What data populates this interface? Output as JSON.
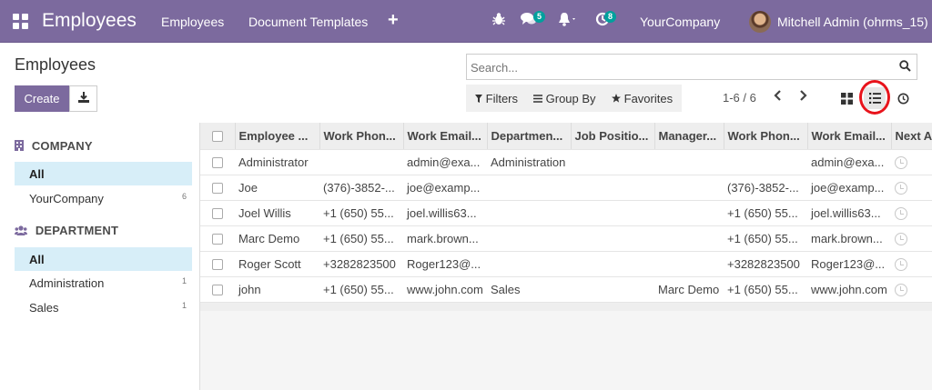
{
  "navbar": {
    "app_title": "Employees",
    "menu": [
      "Employees",
      "Document Templates"
    ],
    "plus": "+",
    "chat_badge": "5",
    "activity_badge": "8",
    "company": "YourCompany",
    "user": "Mitchell Admin (ohrms_15)"
  },
  "control": {
    "title": "Employees",
    "create_label": "Create",
    "search_placeholder": "Search...",
    "filters_label": "Filters",
    "groupby_label": "Group By",
    "favorites_label": "Favorites",
    "pager": "1-6 / 6"
  },
  "sidebar": {
    "company_header": "COMPANY",
    "company_items": [
      {
        "label": "All",
        "count": ""
      },
      {
        "label": "YourCompany",
        "count": "6"
      }
    ],
    "department_header": "DEPARTMENT",
    "department_items": [
      {
        "label": "All",
        "count": ""
      },
      {
        "label": "Administration",
        "count": "1"
      },
      {
        "label": "Sales",
        "count": "1"
      }
    ]
  },
  "table": {
    "headers": [
      "Employee ...",
      "Work Phon...",
      "Work Email...",
      "Departmen...",
      "Job Positio...",
      "Manager...",
      "Work Phon...",
      "Work Email...",
      "Next A"
    ],
    "rows": [
      [
        "Administrator",
        "",
        "admin@exa...",
        "Administration",
        "",
        "",
        "",
        "admin@exa...",
        ""
      ],
      [
        "Joe",
        "(376)-3852-...",
        "joe@examp...",
        "",
        "",
        "",
        "(376)-3852-...",
        "joe@examp...",
        ""
      ],
      [
        "Joel Willis",
        "+1 (650) 55...",
        "joel.willis63...",
        "",
        "",
        "",
        "+1 (650) 55...",
        "joel.willis63...",
        ""
      ],
      [
        "Marc Demo",
        "+1 (650) 55...",
        "mark.brown...",
        "",
        "",
        "",
        "+1 (650) 55...",
        "mark.brown...",
        ""
      ],
      [
        "Roger Scott",
        "+3282823500",
        "Roger123@...",
        "",
        "",
        "",
        "+3282823500",
        "Roger123@...",
        ""
      ],
      [
        "john",
        "+1 (650) 55...",
        "www.john.com",
        "Sales",
        "",
        "Marc Demo",
        "+1 (650) 55...",
        "www.john.com",
        ""
      ]
    ]
  },
  "colors": {
    "brand": "#7c6a9e",
    "badge": "#00a09d",
    "active_filter_bg": "#d7eef8",
    "highlight_ring": "#e8131b"
  },
  "icons": [
    "apps-icon",
    "bug-icon",
    "chat-icon",
    "bell-icon",
    "activity-icon",
    "download-icon",
    "search-icon",
    "kanban-view-icon",
    "list-view-icon",
    "activity-view-icon",
    "building-icon",
    "users-icon",
    "clock-icon"
  ]
}
